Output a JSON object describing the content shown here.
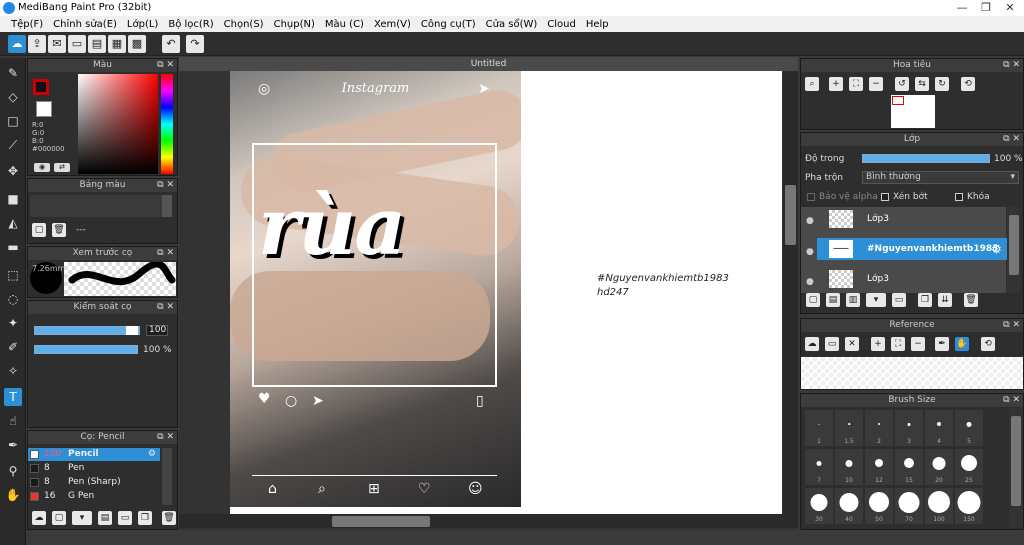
{
  "window": {
    "title": "MediBang Paint Pro (32bit)",
    "min": "—",
    "max": "❐",
    "close": "✕"
  },
  "menu": [
    "Tệp(F)",
    "Chỉnh sửa(E)",
    "Lớp(L)",
    "Bộ lọc(R)",
    "Chọn(S)",
    "Chụp(N)",
    "Màu (C)",
    "Xem(V)",
    "Công cụ(T)",
    "Cửa sổ(W)",
    "Cloud",
    "Help"
  ],
  "document": {
    "tab": "Untitled"
  },
  "color_panel": {
    "title": "Màu",
    "r": "R:0",
    "g": "G:0",
    "b": "B:0",
    "hex": "#000000",
    "fg": "#cc0000",
    "bg": "#ffffff"
  },
  "palette_panel": {
    "title": "Bảng màu",
    "name": "---"
  },
  "brush_preview": {
    "title": "Xem trước cọ",
    "size": "7.26mm"
  },
  "control_panel": {
    "title": "Kiểm soát cọ",
    "size_value": "100",
    "opacity_value": "100 %"
  },
  "brush_list": {
    "title": "Cọ: Pencil",
    "items": [
      {
        "size": "100",
        "name": "Pencil",
        "active": true,
        "color": "#ffffff"
      },
      {
        "size": "8",
        "name": "Pen",
        "active": false,
        "color": "#1a1a1a"
      },
      {
        "size": "8",
        "name": "Pen (Sharp)",
        "active": false,
        "color": "#1a1a1a"
      },
      {
        "size": "16",
        "name": "G Pen",
        "active": false,
        "color": "#e53935"
      }
    ]
  },
  "canvas": {
    "overlay_word": "rùa",
    "instagram": "Instagram",
    "handwriting_line1": "#Nguyenvankhiemtb1983",
    "handwriting_line2": "hd247"
  },
  "navigator": {
    "title": "Hoa tiêu"
  },
  "layer_panel": {
    "title": "Lớp",
    "opacity_label": "Độ trong",
    "opacity_value": "100 %",
    "opacity_level": 1.0,
    "blend_label": "Pha trộn",
    "blend_value": "Bình thường",
    "alpha_label": "Bảo vệ alpha",
    "clip_label": "Xén bớt",
    "lock_label": "Khóa",
    "layers": [
      {
        "name": "Lớp3",
        "selected": false
      },
      {
        "name": "#Nguyenvankhiemtb1983",
        "selected": true
      },
      {
        "name": "Lớp3",
        "selected": false
      }
    ]
  },
  "reference_panel": {
    "title": "Reference"
  },
  "brush_size_panel": {
    "title": "Brush Size",
    "sizes": [
      "1",
      "1.5",
      "2",
      "3",
      "4",
      "5",
      "7",
      "10",
      "12",
      "15",
      "20",
      "25",
      "30",
      "40",
      "50",
      "70",
      "100",
      "150"
    ]
  }
}
